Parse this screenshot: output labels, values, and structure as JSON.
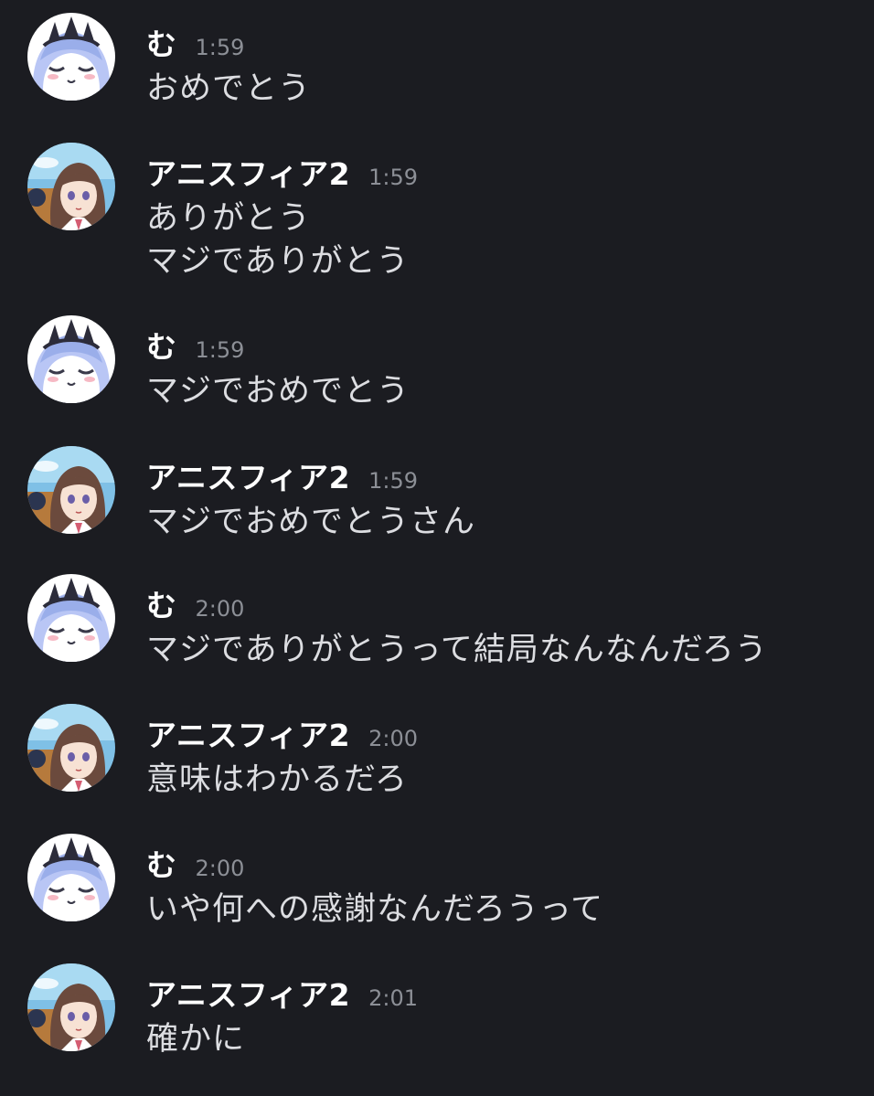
{
  "messages": [
    {
      "user": "む",
      "avatar": "mu-avatar",
      "time": "1:59",
      "lines": [
        "おめでとう"
      ]
    },
    {
      "user": "アニスフィア2",
      "avatar": "anis-avatar",
      "time": "1:59",
      "lines": [
        "ありがとう",
        "マジでありがとう"
      ]
    },
    {
      "user": "む",
      "avatar": "mu-avatar",
      "time": "1:59",
      "lines": [
        "マジでおめでとう"
      ]
    },
    {
      "user": "アニスフィア2",
      "avatar": "anis-avatar",
      "time": "1:59",
      "lines": [
        "マジでおめでとうさん"
      ]
    },
    {
      "user": "む",
      "avatar": "mu-avatar",
      "time": "2:00",
      "lines": [
        "マジでありがとうって結局なんなんだろう"
      ]
    },
    {
      "user": "アニスフィア2",
      "avatar": "anis-avatar",
      "time": "2:00",
      "lines": [
        "意味はわかるだろ"
      ]
    },
    {
      "user": "む",
      "avatar": "mu-avatar",
      "time": "2:00",
      "lines": [
        "いや何への感謝なんだろうって"
      ]
    },
    {
      "user": "アニスフィア2",
      "avatar": "anis-avatar",
      "time": "2:01",
      "lines": [
        "確かに"
      ]
    }
  ],
  "colors": {
    "background": "#1b1c21",
    "username": "#ffffff",
    "timestamp": "#8c8f96",
    "message_text": "#dcdde1"
  }
}
